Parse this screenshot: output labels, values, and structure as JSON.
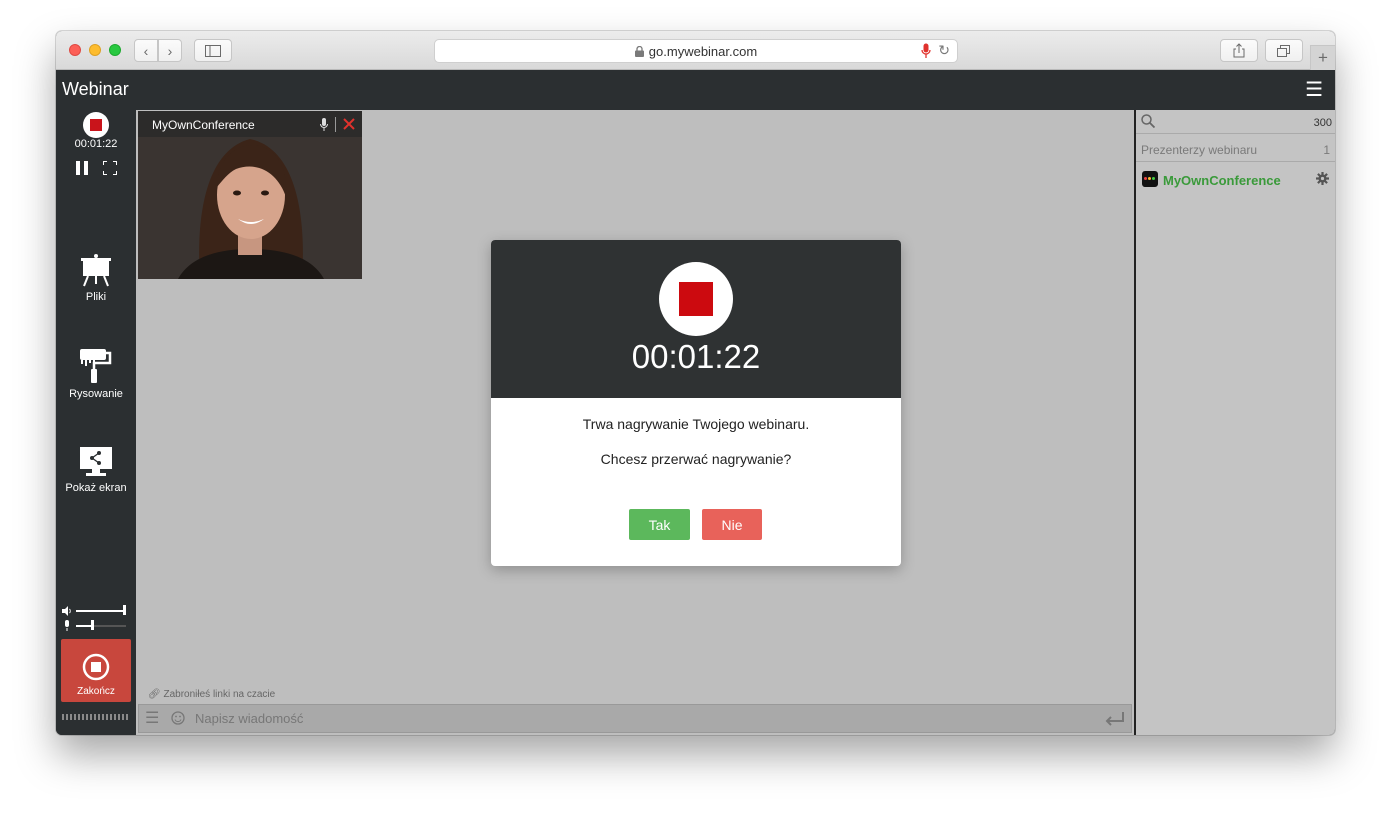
{
  "browser": {
    "url": "go.mywebinar.com"
  },
  "app": {
    "title": "Webinar"
  },
  "sidebar": {
    "timer": "00:01:22",
    "items": [
      {
        "label": "Pliki"
      },
      {
        "label": "Rysowanie"
      },
      {
        "label": "Pokaż ekran"
      }
    ],
    "end_label": "Zakończ"
  },
  "video": {
    "name": "MyOwnConference"
  },
  "modal": {
    "timer": "00:01:22",
    "message": "Trwa nagrywanie Twojego webinaru.",
    "question": "Chcesz przerwać nagrywanie?",
    "yes_label": "Tak",
    "no_label": "Nie",
    "yes_color": "#5cb85c",
    "no_color": "#e8625a"
  },
  "chat": {
    "notice": "Zabroniłeś linki na czacie",
    "placeholder": "Napisz wiadomość"
  },
  "participants": {
    "count": "300",
    "section_label": "Prezenterzy webinaru",
    "section_count": "1",
    "presenter": "MyOwnConference",
    "presenter_color": "#3a9a3a"
  }
}
